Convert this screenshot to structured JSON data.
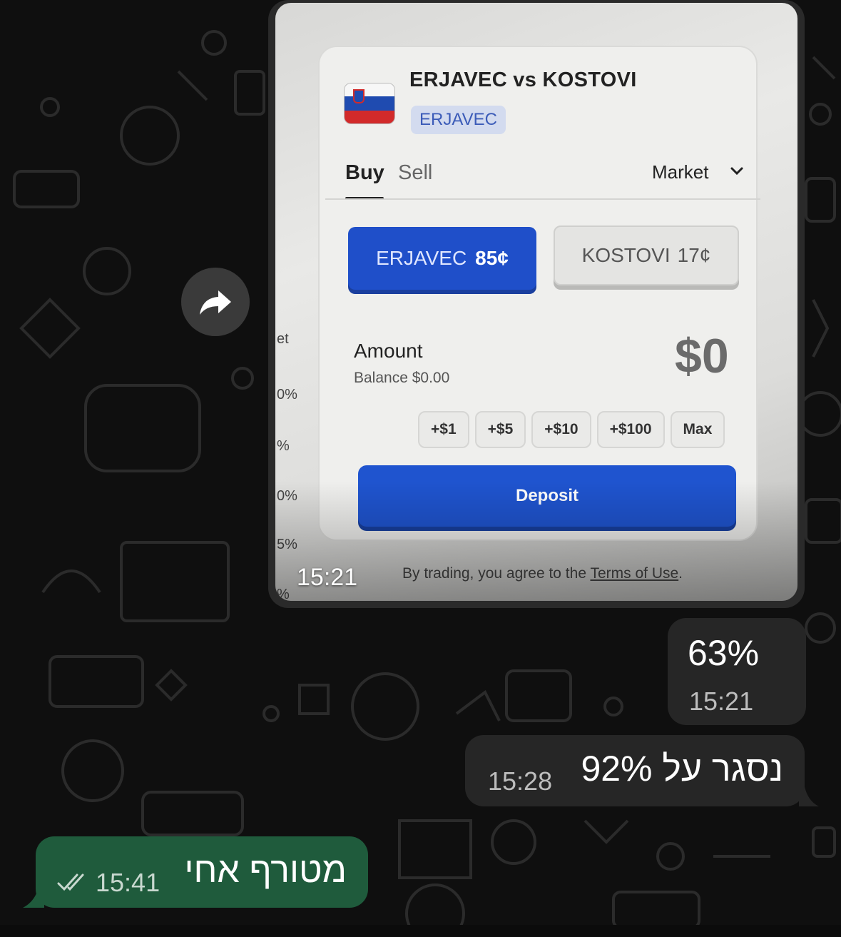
{
  "photo_message": {
    "time": "15:21",
    "card": {
      "title": "ERJAVEC vs KOSTOVI",
      "outcome_tag": "ERJAVEC",
      "tabs": [
        "Buy",
        "Sell"
      ],
      "order_type": "Market",
      "outcomes": [
        {
          "name": "ERJAVEC",
          "price": "85¢",
          "selected": true
        },
        {
          "name": "KOSTOVI",
          "price": "17¢",
          "selected": false
        }
      ],
      "amount_label": "Amount",
      "balance": "Balance $0.00",
      "amount_value": "$0",
      "quick_amounts": [
        "+$1",
        "+$5",
        "+$10",
        "+$100",
        "Max"
      ],
      "deposit_label": "Deposit",
      "terms_prefix": "By trading, you agree to the ",
      "terms_link": "Terms of Use",
      "terms_suffix": "."
    },
    "left_edge_fragments": [
      "et",
      "0%",
      "%",
      "0%",
      "5%",
      "%"
    ]
  },
  "messages": [
    {
      "text": "63%",
      "time": "15:21",
      "direction": "incoming"
    },
    {
      "text": "נסגר על 92%",
      "time": "15:28",
      "direction": "incoming"
    },
    {
      "text": "מטורף אחי",
      "time": "15:41",
      "direction": "outgoing",
      "status": "read"
    }
  ],
  "icons": {
    "forward": "forward-arrow-icon",
    "read_receipt": "double-check-icon",
    "dropdown": "chevron-down-icon"
  },
  "colors": {
    "background": "#0f0f0f",
    "incoming_bubble": "#262626",
    "outgoing_bubble": "#1f5b3c",
    "primary_blue": "#1f4fc9"
  }
}
